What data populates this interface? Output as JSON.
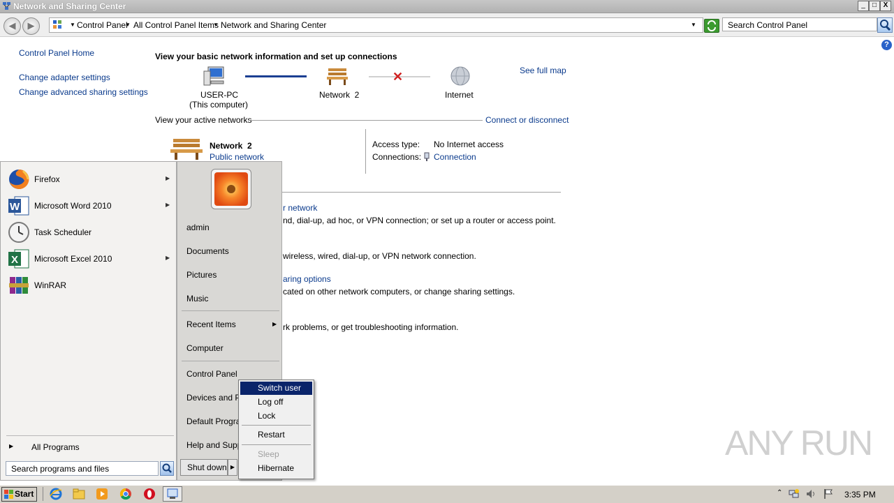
{
  "window": {
    "title": "Network and Sharing Center",
    "min_label": "_",
    "max_label": "□",
    "close_label": "X"
  },
  "addressbar": {
    "crumbs": [
      "Control Panel",
      "All Control Panel Items",
      "Network and Sharing Center"
    ],
    "search_placeholder": "Search Control Panel"
  },
  "sidebar": {
    "home": "Control Panel Home",
    "links": [
      "Change adapter settings",
      "Change advanced sharing settings"
    ]
  },
  "main": {
    "heading": "View your basic network information and set up connections",
    "see_full_map": "See full map",
    "map": {
      "computer_name": "USER-PC",
      "computer_sub": "(This computer)",
      "network_name": "Network  2",
      "internet": "Internet"
    },
    "active_heading": "View your active networks",
    "connect_link": "Connect or disconnect",
    "network": {
      "name": "Network  2",
      "type": "Public network",
      "access_label": "Access type:",
      "access_value": "No Internet access",
      "connections_label": "Connections:",
      "connections_value": "Connection"
    },
    "tasks": [
      {
        "link": "r network",
        "desc": "nd, dial-up, ad hoc, or VPN connection; or set up a router or access point."
      },
      {
        "link": "",
        "desc": "wireless, wired, dial-up, or VPN network connection."
      },
      {
        "link": "aring options",
        "desc": "cated on other network computers, or change sharing settings."
      },
      {
        "link": "",
        "desc": "rk problems, or get troubleshooting information."
      }
    ]
  },
  "startmenu": {
    "programs": [
      "Firefox",
      "Microsoft Word 2010",
      "Task Scheduler",
      "Microsoft Excel 2010",
      "WinRAR"
    ],
    "all_programs": "All Programs",
    "search_placeholder": "Search programs and files",
    "right_items": [
      "admin",
      "Documents",
      "Pictures",
      "Music",
      "Recent Items",
      "Computer",
      "Control Panel",
      "Devices and Pri",
      "Default Prograr",
      "Help and Suppo"
    ],
    "shutdown_label": "Shut down"
  },
  "power_menu": {
    "items": [
      "Switch user",
      "Log off",
      "Lock",
      "Restart",
      "Sleep",
      "Hibernate"
    ],
    "highlighted": "Switch user",
    "disabled": "Sleep",
    "highlight_color": "#0a246a"
  },
  "taskbar": {
    "start_label": "Start",
    "clock": "3:35 PM"
  },
  "watermark": "ANY RUN"
}
